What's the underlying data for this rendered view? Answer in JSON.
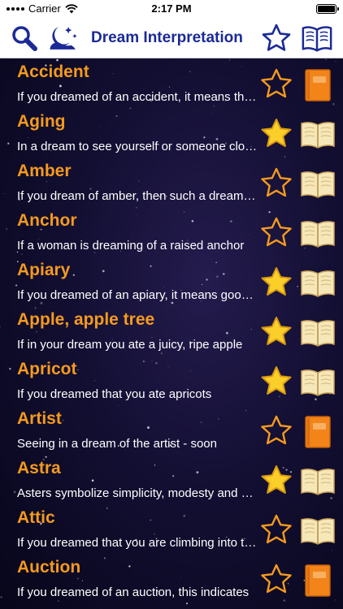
{
  "status": {
    "carrier": "Carrier",
    "time": "2:17 PM"
  },
  "header": {
    "title": "Dream Interpretation",
    "icons": [
      "search-icon",
      "moon-stars-icon",
      "star-outline-icon",
      "open-book-icon"
    ]
  },
  "colors": {
    "title_blue": "#1b2a96",
    "entry_orange": "#f59a1e",
    "star_gold": "#fbcf2a",
    "book_orange": "#f2841a",
    "book_cream": "#f6e7b8"
  },
  "entries": [
    {
      "title": "Accident",
      "desc": "If you dreamed of an accident, it means that you should be more careful",
      "favorite": false,
      "book": "closed"
    },
    {
      "title": "Aging",
      "desc": "In a dream to see yourself or someone close to you aging",
      "favorite": true,
      "book": "open"
    },
    {
      "title": "Amber",
      "desc": "If you dream of amber, then such a dream promises",
      "favorite": false,
      "book": "open"
    },
    {
      "title": "Anchor",
      "desc": "If a woman is dreaming of a raised anchor",
      "favorite": false,
      "book": "open"
    },
    {
      "title": "Apiary",
      "desc": "If you dreamed of an apiary, it means good luck",
      "favorite": true,
      "book": "open"
    },
    {
      "title": "Apple, apple tree",
      "desc": "If in your dream you ate a juicy, ripe apple",
      "favorite": true,
      "book": "open"
    },
    {
      "title": "Apricot",
      "desc": "If you dreamed that you ate apricots",
      "favorite": true,
      "book": "open"
    },
    {
      "title": "Artist",
      "desc": "Seeing in a dream of the artist - soon",
      "favorite": false,
      "book": "closed"
    },
    {
      "title": "Astra",
      "desc": "Asters symbolize simplicity, modesty and kindness",
      "favorite": true,
      "book": "open"
    },
    {
      "title": "Attic",
      "desc": "If you dreamed that you are climbing into the attic",
      "favorite": false,
      "book": "open"
    },
    {
      "title": "Auction",
      "desc": "If you dreamed of an auction, this indicates",
      "favorite": false,
      "book": "closed"
    }
  ]
}
